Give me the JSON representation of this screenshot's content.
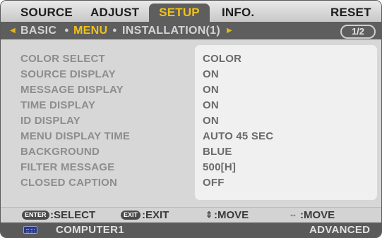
{
  "tabs": [
    {
      "label": "SOURCE"
    },
    {
      "label": "ADJUST"
    },
    {
      "label": "SETUP"
    },
    {
      "label": "INFO."
    },
    {
      "label": "RESET"
    }
  ],
  "subtabs": [
    {
      "label": "BASIC"
    },
    {
      "label": "MENU"
    },
    {
      "label": "INSTALLATION(1)"
    }
  ],
  "page_indicator": "1/2",
  "settings": [
    {
      "label": "COLOR SELECT",
      "value": "COLOR"
    },
    {
      "label": "SOURCE DISPLAY",
      "value": "ON"
    },
    {
      "label": "MESSAGE DISPLAY",
      "value": "ON"
    },
    {
      "label": "TIME DISPLAY",
      "value": "ON"
    },
    {
      "label": "ID DISPLAY",
      "value": "ON"
    },
    {
      "label": "MENU DISPLAY TIME",
      "value": "AUTO 45 SEC"
    },
    {
      "label": "BACKGROUND",
      "value": "BLUE"
    },
    {
      "label": "FILTER MESSAGE",
      "value": "500[H]"
    },
    {
      "label": "CLOSED CAPTION",
      "value": "OFF"
    }
  ],
  "help": {
    "enter_key": "ENTER",
    "select": ":SELECT",
    "exit_key": "EXIT",
    "exit": ":EXIT",
    "move_vertical": ":MOVE",
    "move_horizontal": ":MOVE"
  },
  "status": {
    "source_icon": "computer-input-icon",
    "source": "COMPUTER1",
    "mode": "ADVANCED"
  },
  "colors": {
    "active_tab_text": "#f2c21a",
    "tab_bar_dark": "#5e5e5e"
  }
}
